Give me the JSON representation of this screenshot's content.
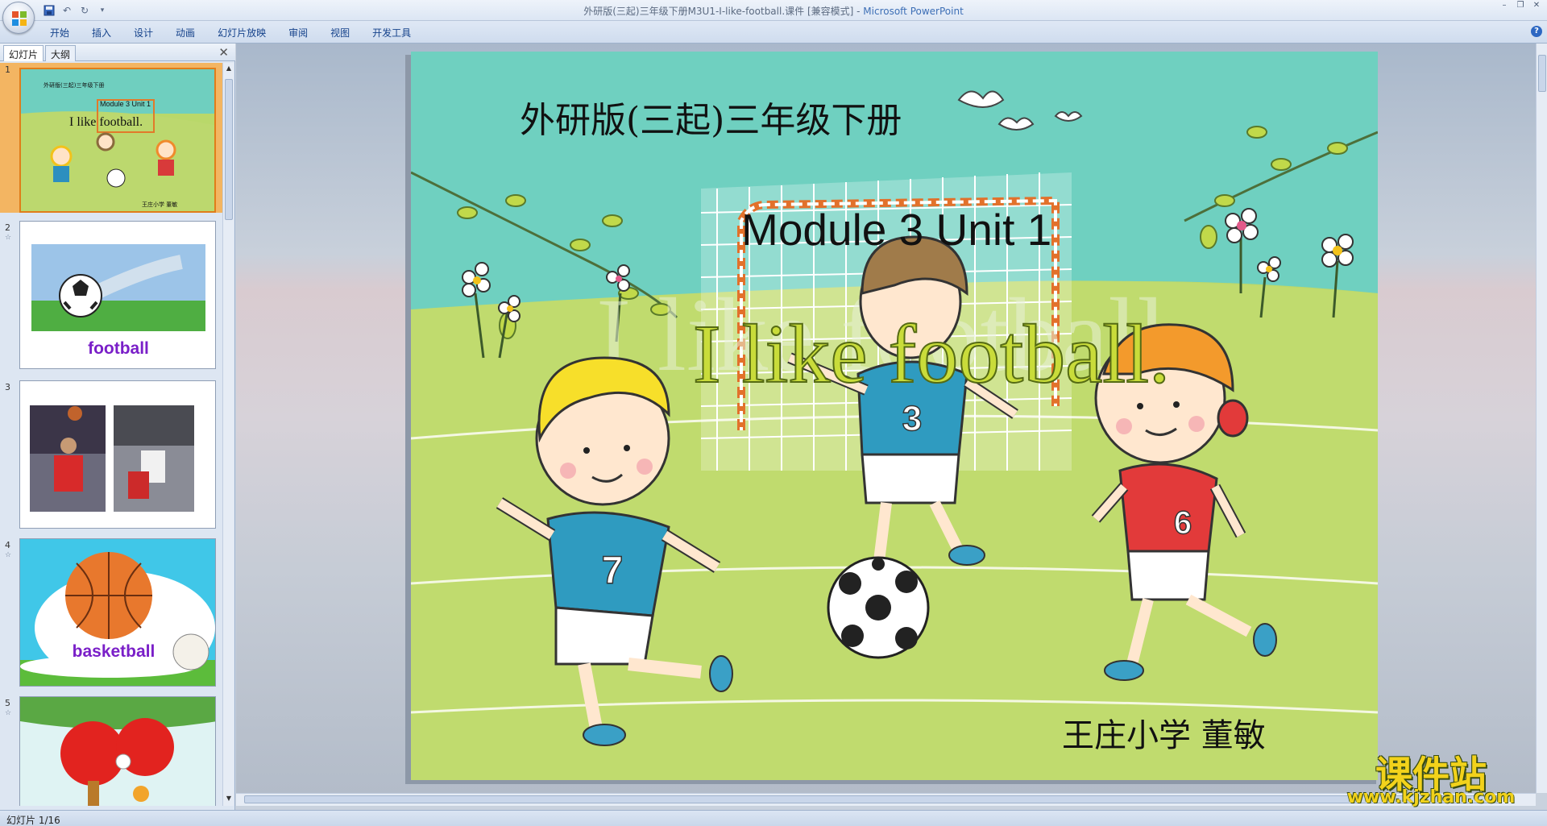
{
  "window": {
    "title": "外研版(三起)三年级下册M3U1-I-like-football.课件 [兼容模式] - ",
    "app_name": "Microsoft PowerPoint"
  },
  "ribbon": {
    "tabs": [
      "开始",
      "插入",
      "设计",
      "动画",
      "幻灯片放映",
      "审阅",
      "视图",
      "开发工具"
    ]
  },
  "panel": {
    "tabs": [
      "幻灯片",
      "大纲"
    ],
    "close_glyph": "✕"
  },
  "thumbnails": [
    {
      "num": "1",
      "selected": true,
      "publisher": "外研版(三起)三年级下册",
      "module": "Module 3 Unit 1",
      "title": "I like football.",
      "author": "王庄小学  董敏"
    },
    {
      "num": "2",
      "word": "football"
    },
    {
      "num": "3"
    },
    {
      "num": "4",
      "word": "basketball"
    },
    {
      "num": "5"
    }
  ],
  "slide": {
    "publisher": "外研版(三起)三年级下册",
    "module": "Module 3 Unit 1",
    "title": "I like football.",
    "author": "王庄小学   董敏",
    "jersey_numbers": [
      "7",
      "3",
      "6"
    ]
  },
  "status": {
    "slide_counter": "幻灯片 1/16"
  },
  "watermark": {
    "big": "课件站",
    "small": "www.kjzhan.com"
  },
  "colors": {
    "ribbon_text": "#15428b",
    "selected_thumb": "#f3b562",
    "word_purple": "#7a1fc8"
  }
}
